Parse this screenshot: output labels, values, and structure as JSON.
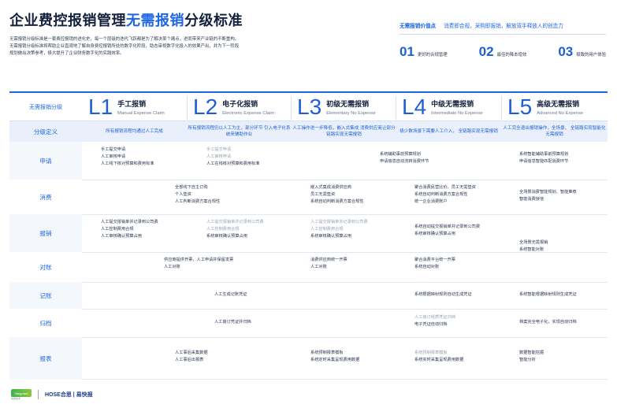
{
  "header": {
    "title_prefix": "企业费控报销管理",
    "title_highlight": "无需报销",
    "title_suffix": "分级标准"
  },
  "intro": {
    "lines": [
      "无需报销分级标准是一套费控报销的进化史，每一个层级的迭代飞跃都是为了解决某个痛点，进而带来产业链的不断重构。",
      "无需报销分级标准将帮助企业直观地了解自身费控报销所处的数字化阶段，助态审视数字化投入的效果产出，并为下一阶段",
      "规划做出决策参考，极大提升了企业财务数字化的实践效率。"
    ]
  },
  "value": {
    "label": "无需报销价值点",
    "text": "消费即合规，采购即报销，解放双手释放人的创造力",
    "stats": [
      {
        "num": "01",
        "label": "更好的合规管理"
      },
      {
        "num": "02",
        "label": "最佳的降本增效"
      },
      {
        "num": "03",
        "label": "极致的用户体验"
      }
    ]
  },
  "table": {
    "header_label": "无需报销分级",
    "levels": [
      {
        "code": "L1",
        "cn": "手工报销",
        "en": "Manual Expense Claim"
      },
      {
        "code": "L2",
        "cn": "电子化报销",
        "en": "Electronic Expense Claim"
      },
      {
        "code": "L3",
        "cn": "初级无需报销",
        "en": "Elementary No Expense"
      },
      {
        "code": "L4",
        "cn": "中级无需报销",
        "en": "Intermediate No Expense"
      },
      {
        "code": "L5",
        "cn": "高级无需报销",
        "en": "Advanced No Expense"
      }
    ],
    "row_labels": [
      "分级定义",
      "申请",
      "消费",
      "报销",
      "对账",
      "记账",
      "归档",
      "报表"
    ],
    "definitions": [
      "所有报销流程均通过人工完成",
      "所有报销流程仍以人工为主，部分环节 引入电子化系统来辅助作业",
      "人工操作进一步降低，嵌入式集成 消费供应商让部分链路实现无需报销",
      "极少数场景下需要人工介入， 全链路实现无需报销",
      "人工完全退出报销操作，全场景、 全链路实现智能化无需报销"
    ],
    "apply": {
      "l1": [
        "手工提交申请",
        "人工审核申请",
        "人工线下核对预算和费用标准"
      ],
      "l2": [
        "手工提交申请",
        "人工审核申请",
        "人工在线核对预算和费用标准"
      ],
      "l34": [
        "系统辅助事前预算规划",
        "申请信息自动流转消费环节"
      ],
      "l5": [
        "系统智能辅助事前预算规划",
        "申请信息智能匹配消费环节"
      ]
    },
    "consume": {
      "l12": [
        "全部线下自主订购",
        "个人垫资",
        "人工判断消费方案合规性"
      ],
      "l3": [
        "嵌入式集成消费供应商",
        "员工无需垫资",
        "系统自动判断消费方案合规性"
      ],
      "l4": [
        "聚合消费民营比价，员工无需垫资",
        "系统自动判断消费方案合规性",
        "统一企业消费账户"
      ],
      "l5": [
        "全场景消费智能规划、智能推荐",
        "智能消费授信"
      ]
    },
    "claim": {
      "l1": [
        "人工提交报销单并记录到公司费",
        "人工控制费用合规",
        "人工审核确认预算占用"
      ],
      "l2": [
        "人工提交报销单并记录到公司费",
        "人工控制费用合规",
        "系统审核确认预算占用"
      ],
      "l3": [
        "人工提交报销单并记录到公司费",
        "人工控制费用合规",
        "系统审核确认预算占用"
      ],
      "l4": [
        "系统自动提交报销单并记录到公司费",
        "系统审核确认预算占用"
      ],
      "l5": [
        "全场景无需报销",
        "系统智能对账"
      ]
    },
    "reconcile": {
      "l12": [
        "供应商提供开票，人工申请并保留发票",
        "人工对账"
      ],
      "l3": [
        "消费供应商统一开票",
        "人工对账"
      ],
      "l4": [
        "聚合消费平台统一开票",
        "系统自动对账"
      ]
    },
    "bookkeep": {
      "l123": [
        "人工生成记账凭证"
      ],
      "l4": [
        "系统根据映射规则自动生成凭证"
      ],
      "l5": [
        "系统智能根据映射规则生成凭证"
      ]
    },
    "archive": {
      "l123": [
        "人工装订凭证并归档"
      ],
      "l4": [
        "人工装订纸质凭证归档",
        "电子凭证自动归档"
      ],
      "l5": [
        "档案完全电子化，实现自动归档"
      ]
    },
    "report": {
      "l12": [
        "人工事后采集数据",
        "人工事后出报表"
      ],
      "l3": [
        "系统预制报表模板",
        "系统定时采集呈现费用数据"
      ],
      "l4": [
        "系统预制报表模板",
        "系统实时采集呈现费用数据"
      ],
      "l5": [
        "数据智能挖掘",
        "智能分析"
      ]
    }
  },
  "footer": {
    "logo1_text": "Vanguard",
    "logo1_sub": "先锋技术",
    "logo2_text": "HOSE合思 | 易快报"
  }
}
